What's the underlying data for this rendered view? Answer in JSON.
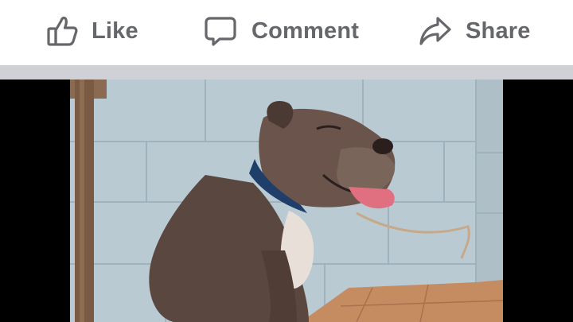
{
  "actions": {
    "like_label": "Like",
    "comment_label": "Comment",
    "share_label": "Share"
  },
  "icons": {
    "like": "thumbs-up-icon",
    "comment": "speech-bubble-icon",
    "share": "share-arrow-icon"
  },
  "colors": {
    "action_text": "#65676b",
    "divider": "#cfd1d6",
    "media_background": "#000000",
    "wall": "#b9cad3",
    "floor": "#c58c62",
    "dog": "#5a4740",
    "collar": "#1f3e6a",
    "tongue": "#e07080"
  },
  "post_media": {
    "type": "photo",
    "subject": "dog"
  }
}
